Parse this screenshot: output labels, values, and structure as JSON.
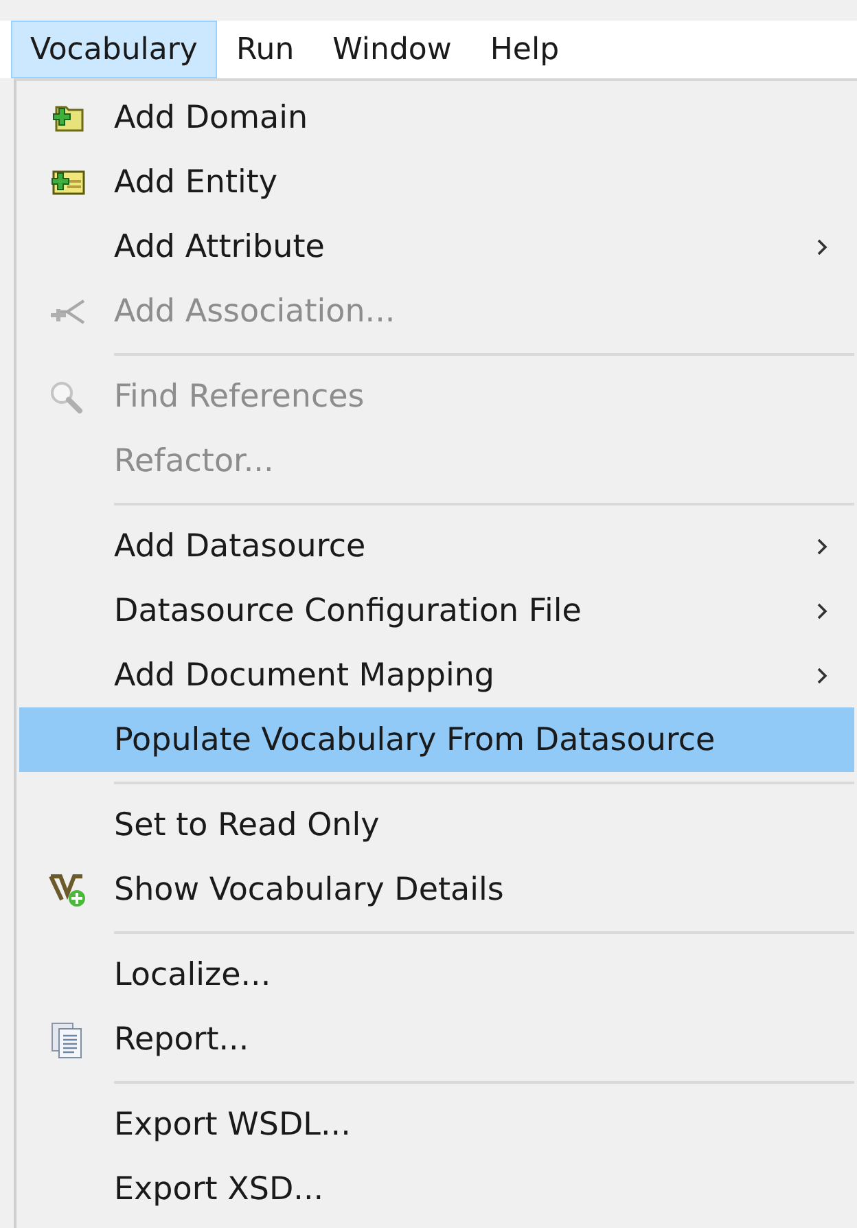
{
  "menubar": [
    {
      "label": "Vocabulary",
      "selected": true
    },
    {
      "label": "Run",
      "selected": false
    },
    {
      "label": "Window",
      "selected": false
    },
    {
      "label": "Help",
      "selected": false
    }
  ],
  "menu": [
    {
      "kind": "item",
      "label": "Add Domain",
      "disabled": false,
      "submenu": false,
      "selected": false
    },
    {
      "kind": "item",
      "label": "Add Entity",
      "disabled": false,
      "submenu": false,
      "selected": false
    },
    {
      "kind": "item",
      "label": "Add Attribute",
      "disabled": false,
      "submenu": true,
      "selected": false
    },
    {
      "kind": "item",
      "label": "Add Association...",
      "disabled": true,
      "submenu": false,
      "selected": false
    },
    {
      "kind": "separator"
    },
    {
      "kind": "item",
      "label": "Find References",
      "disabled": true,
      "submenu": false,
      "selected": false
    },
    {
      "kind": "item",
      "label": "Refactor...",
      "disabled": true,
      "submenu": false,
      "selected": false
    },
    {
      "kind": "separator"
    },
    {
      "kind": "item",
      "label": "Add Datasource",
      "disabled": false,
      "submenu": true,
      "selected": false
    },
    {
      "kind": "item",
      "label": "Datasource Configuration File",
      "disabled": false,
      "submenu": true,
      "selected": false
    },
    {
      "kind": "item",
      "label": "Add Document Mapping",
      "disabled": false,
      "submenu": true,
      "selected": false
    },
    {
      "kind": "item",
      "label": "Populate Vocabulary From Datasource",
      "disabled": false,
      "submenu": false,
      "selected": true
    },
    {
      "kind": "separator"
    },
    {
      "kind": "item",
      "label": "Set to Read Only",
      "disabled": false,
      "submenu": false,
      "selected": false
    },
    {
      "kind": "item",
      "label": "Show Vocabulary Details",
      "disabled": false,
      "submenu": false,
      "selected": false
    },
    {
      "kind": "separator"
    },
    {
      "kind": "item",
      "label": "Localize...",
      "disabled": false,
      "submenu": false,
      "selected": false
    },
    {
      "kind": "item",
      "label": "Report...",
      "disabled": false,
      "submenu": false,
      "selected": false
    },
    {
      "kind": "separator"
    },
    {
      "kind": "item",
      "label": "Export WSDL...",
      "disabled": false,
      "submenu": false,
      "selected": false
    },
    {
      "kind": "item",
      "label": "Export XSD...",
      "disabled": false,
      "submenu": false,
      "selected": false
    }
  ]
}
